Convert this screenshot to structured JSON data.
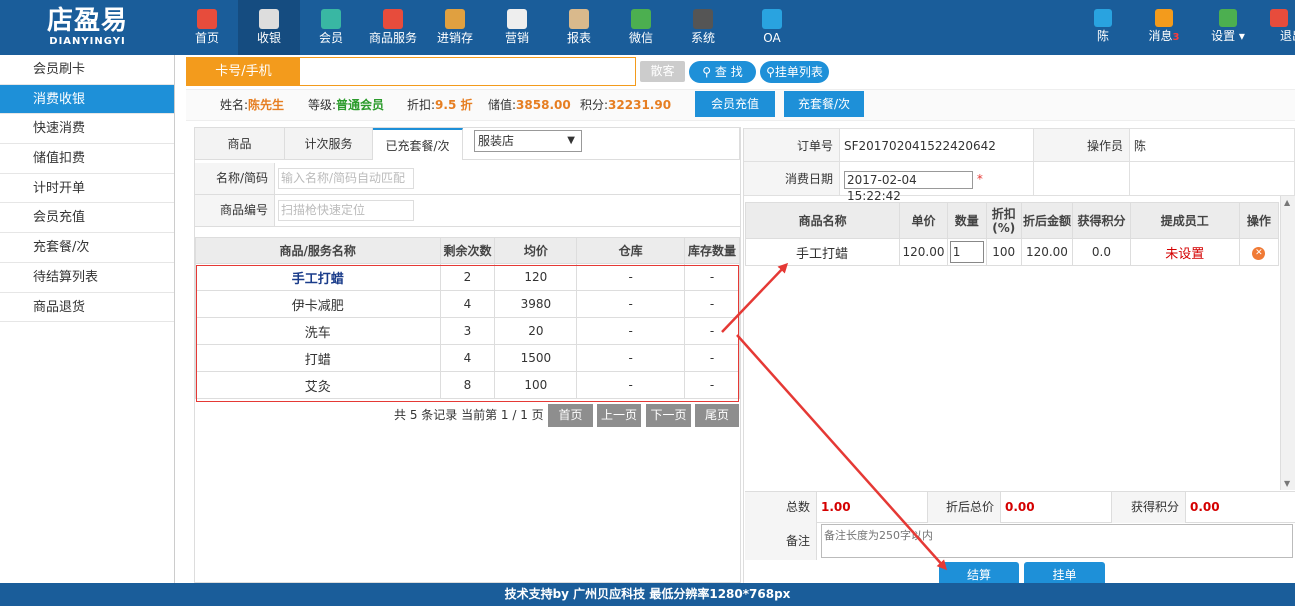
{
  "app": {
    "logo_main": "店盈易",
    "logo_sub": "DIANYINGYI"
  },
  "nav": [
    {
      "label": "首页",
      "icon": "home-icon",
      "color": "#e74c3c"
    },
    {
      "label": "收银",
      "icon": "cash-register-icon",
      "color": "#dddddd"
    },
    {
      "label": "会员",
      "icon": "member-icon",
      "color": "#39b7a3"
    },
    {
      "label": "商品服务",
      "icon": "product-service-icon",
      "color": "#e74c3c"
    },
    {
      "label": "进销存",
      "icon": "inventory-icon",
      "color": "#e0a040"
    },
    {
      "label": "营销",
      "icon": "megaphone-icon",
      "color": "#eeeeee"
    },
    {
      "label": "报表",
      "icon": "report-icon",
      "color": "#d9b98c"
    },
    {
      "label": "微信",
      "icon": "wechat-icon",
      "color": "#4caf50"
    },
    {
      "label": "系统",
      "icon": "monitor-icon",
      "color": "#555555"
    },
    {
      "label": "OA",
      "icon": "oa-icon",
      "color": "#29a3e0"
    }
  ],
  "nav_right": [
    {
      "label": "陈",
      "icon": "user-icon",
      "color": "#29a3e0"
    },
    {
      "label": "消息",
      "badge": "3",
      "icon": "bell-icon",
      "color": "#f39b1c"
    },
    {
      "label": "设置",
      "icon": "settings-icon",
      "color": "#4caf50"
    },
    {
      "label": "退出",
      "icon": "logout-icon",
      "color": "#e74c3c"
    }
  ],
  "sidebar": [
    {
      "label": "会员刷卡"
    },
    {
      "label": "消费收银",
      "active": true
    },
    {
      "label": "快速消费"
    },
    {
      "label": "储值扣费"
    },
    {
      "label": "计时开单"
    },
    {
      "label": "会员充值"
    },
    {
      "label": "充套餐/次"
    },
    {
      "label": "待结算列表"
    },
    {
      "label": "商品退货"
    }
  ],
  "card_search": {
    "label": "卡号/手机",
    "value": "",
    "guest_button": "散客",
    "search_button": "查 找",
    "held_orders_button": "挂单列表"
  },
  "member": {
    "name_label": "姓名:",
    "name": "陈先生",
    "level_label": "等级:",
    "level": "普通会员",
    "discount_label": "折扣:",
    "discount": "9.5 折",
    "balance_label": "储值:",
    "balance": "3858.00",
    "points_label": "积分:",
    "points": "32231.90",
    "recharge_button": "会员充值",
    "package_button": "充套餐/次"
  },
  "product_tabs": [
    {
      "label": "商品"
    },
    {
      "label": "计次服务"
    },
    {
      "label": "已充套餐/次",
      "active": true
    }
  ],
  "store_select": {
    "selected": "服装店"
  },
  "filters": {
    "name_label": "名称/简码",
    "name_placeholder": "输入名称/简码自动匹配",
    "code_label": "商品编号",
    "code_placeholder": "扫描枪快速定位"
  },
  "package_table": {
    "headers": [
      "商品/服务名称",
      "剩余次数",
      "均价",
      "仓库",
      "库存数量"
    ],
    "rows": [
      {
        "name": "手工打蜡",
        "remaining": "2",
        "avg": "120",
        "warehouse": "-",
        "stock": "-",
        "highlight": true
      },
      {
        "name": "伊卡减肥",
        "remaining": "4",
        "avg": "3980",
        "warehouse": "-",
        "stock": "-"
      },
      {
        "name": "洗车",
        "remaining": "3",
        "avg": "20",
        "warehouse": "-",
        "stock": "-"
      },
      {
        "name": "打蜡",
        "remaining": "4",
        "avg": "1500",
        "warehouse": "-",
        "stock": "-"
      },
      {
        "name": "艾灸",
        "remaining": "8",
        "avg": "100",
        "warehouse": "-",
        "stock": "-"
      }
    ]
  },
  "pager": {
    "summary": "共 5 条记录 当前第 1 / 1 页",
    "first": "首页",
    "prev": "上一页",
    "next": "下一页",
    "last": "尾页"
  },
  "order": {
    "order_no_label": "订单号",
    "order_no": "SF201702041522420642",
    "operator_label": "操作员",
    "operator": "陈",
    "date_label": "消费日期",
    "date": "2017-02-04 15:22:42",
    "required_mark": "*"
  },
  "order_table": {
    "headers": [
      "商品名称",
      "单价",
      "数量",
      "折扣\n(%)",
      "折后金额",
      "获得积分",
      "提成员工",
      "操作"
    ],
    "rows": [
      {
        "name": "手工打蜡",
        "price": "120.00",
        "qty": "1",
        "discount": "100",
        "amount": "120.00",
        "points": "0.0",
        "staff": "未设置"
      }
    ]
  },
  "totals": {
    "count_label": "总数",
    "count": "1.00",
    "total_label": "折后总价",
    "total": "0.00",
    "points_label": "获得积分",
    "points": "0.00"
  },
  "remark": {
    "label": "备注",
    "placeholder": "备注长度为250字以内"
  },
  "actions": {
    "checkout": "结算",
    "hold": "挂单"
  },
  "footer": {
    "text": "技术支持by 广州贝应科技    最低分辨率1280*768px"
  },
  "colors": {
    "header": "#1a5d9a",
    "accent": "#1e90d8",
    "orange": "#f39b1c",
    "annotation": "#e53935"
  }
}
